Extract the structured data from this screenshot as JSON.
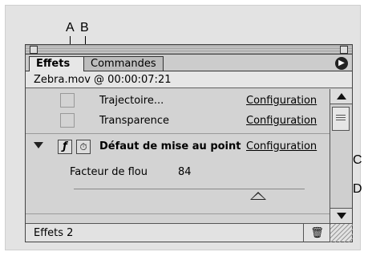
{
  "callouts": {
    "a": "A",
    "b": "B",
    "c": "C",
    "d": "D"
  },
  "tabs": {
    "effects": "Effets",
    "commands": "Commandes"
  },
  "clip": {
    "label": "Zebra.mov @ 00:00:07:21"
  },
  "rows": [
    {
      "label": "Trajectoire...",
      "config": "Configuration"
    },
    {
      "label": "Transparence",
      "config": "Configuration"
    },
    {
      "label": "Défaut de mise au point",
      "config": "Configuration"
    }
  ],
  "param": {
    "label": "Facteur de flou",
    "value": "84"
  },
  "status": {
    "label": "Effets 2"
  },
  "icons": {
    "f": "ƒ",
    "timer": "⏱",
    "trash": "🗑",
    "menu": "▶"
  }
}
